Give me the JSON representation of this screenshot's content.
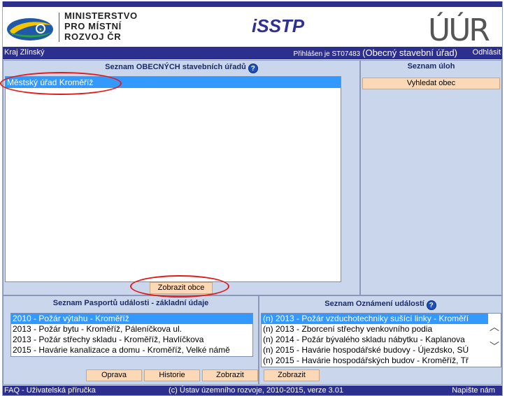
{
  "header": {
    "ministry_line1": "MINISTERSTVO",
    "ministry_line2": "PRO MÍSTNÍ",
    "ministry_line3": "ROZVOJ ČR",
    "app_title": "iSSTP",
    "uur_logo_text": "ÚÚR"
  },
  "userbar": {
    "region": "Kraj Zlínský",
    "login_prefix": "Přihlášen je ST07483",
    "login_role": "(Obecný stavební úřad)",
    "logout": "Odhlásit"
  },
  "offices_panel": {
    "title": "Seznam OBECNÝCH stavebních úřadů",
    "items": [
      "Městský úřad Kroměříž"
    ],
    "show_button": "Zobrazit obce"
  },
  "tasks_panel": {
    "title": "Seznam úloh",
    "search_button": "Vyhledat obec"
  },
  "passports_panel": {
    "title": "Seznam Pasportů události - základní údaje",
    "items": [
      "2010 - Požár výtahu - Kroměříž",
      "2013 - Požár bytu - Kroměříž, Páleníčkova ul.",
      "2013 - Požár střechy skladu - Kroměříž, Havlíčkova",
      "2015 - Havárie kanalizace a domu - Kroměříž, Velké námě"
    ],
    "buttons": {
      "edit": "Oprava",
      "history": "Historie",
      "show": "Zobrazit"
    }
  },
  "notices_panel": {
    "title": "Seznam Oznámení událostí",
    "items": [
      "(n) 2013 - Požár vzduchotechniky sušící linky - Kroměří",
      "(n) 2013 - Zborcení střechy venkovního podia",
      "(n) 2014 - Požár bývalého skladu nábytku - Kaplanova",
      "(n) 2015 - Havárie hospodářské budovy - Újezdsko, SÚ",
      "(n) 2015 - Havárie hospodářských budov - Kroměříž, Tř"
    ],
    "show_button": "Zobrazit"
  },
  "footer": {
    "faq": "FAQ - Uživatelská příručka",
    "copyright": "(c) Ústav územního rozvoje, 2010-2015, verze 3.01",
    "contact": "Napište nám"
  },
  "icons": [
    "mmr-logo-icon",
    "uur-logo-icon",
    "help-icon",
    "chevron-up-icon",
    "chevron-down-icon"
  ],
  "colors": {
    "navy": "#2d2f8f",
    "panel": "#c9d6ec",
    "button": "#fcd9b6",
    "selected": "#3399ff",
    "annotation": "#e01b1b"
  }
}
